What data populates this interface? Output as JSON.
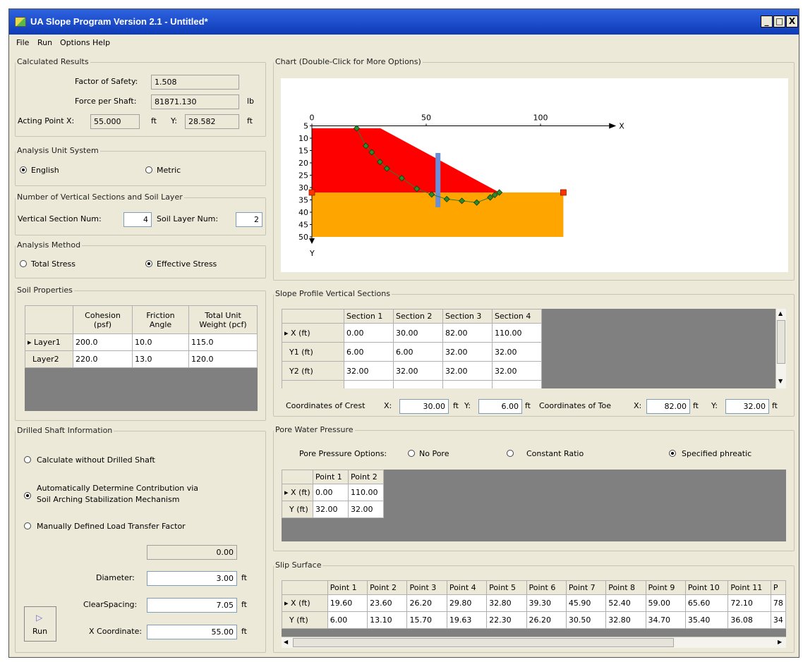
{
  "window": {
    "title": "UA Slope Program Version 2.1 - Untitled*",
    "controls": [
      "_",
      "□",
      "X"
    ]
  },
  "menu": [
    "File",
    "Run",
    "Options",
    "Help"
  ],
  "results": {
    "group": "Calculated Results",
    "fos_label": "Factor of Safety:",
    "fos": "1.508",
    "force_label": "Force per Shaft:",
    "force": "81871.130",
    "force_unit": "lb",
    "acting_label": "Acting Point X:",
    "acting_x": "55.000",
    "x_unit": "ft",
    "y_label": "Y:",
    "acting_y": "28.582",
    "y_unit": "ft"
  },
  "units": {
    "group": "Analysis Unit System",
    "english": "English",
    "metric": "Metric",
    "selected": "English"
  },
  "sections": {
    "group": "Number of Vertical Sections and Soil Layer",
    "vs_label": "Vertical Section Num:",
    "vs": "4",
    "sl_label": "Soil Layer Num:",
    "sl": "2"
  },
  "method": {
    "group": "Analysis Method",
    "total": "Total Stress",
    "effective": "Effective Stress",
    "selected": "Effective Stress"
  },
  "soil": {
    "group": "Soil Properties",
    "headers": [
      "Cohesion (psf)",
      "Friction Angle",
      "Total Unit Weight (pcf)"
    ],
    "rows": [
      {
        "name": "Layer1",
        "vals": [
          "200.0",
          "10.0",
          "115.0"
        ]
      },
      {
        "name": "Layer2",
        "vals": [
          "220.0",
          "13.0",
          "120.0"
        ]
      }
    ]
  },
  "shaft": {
    "group": "Drilled Shaft Information",
    "opt1": "Calculate without Drilled Shaft",
    "opt2a": "Automatically Determine Contribution via",
    "opt2b": "Soil Arching Stabilization Mechanism",
    "opt3": "Manually Defined Load Transfer Factor",
    "ltf": "0.00",
    "dia_label": "Diameter:",
    "dia": "3.00",
    "dia_unit": "ft",
    "cs_label": "ClearSpacing:",
    "cs": "7.05",
    "cs_unit": "ft",
    "xc_label": "X Coordinate:",
    "xc": "55.00",
    "xc_unit": "ft",
    "run": "Run"
  },
  "chart": {
    "group": "Chart (Double-Click for More Options)",
    "x_axis_label": "X",
    "y_axis_label": "Y",
    "x_ticks": [
      "0",
      "50",
      "100"
    ],
    "y_ticks": [
      "5",
      "10",
      "15",
      "20",
      "25",
      "30",
      "35",
      "40",
      "45",
      "50"
    ],
    "colors": {
      "layer1": "#ff0000",
      "layer2": "#ffa500",
      "shaft": "#6a8ed8",
      "slip": "#2e7d32"
    },
    "chart_data": {
      "type": "scatter",
      "x_ticks": [
        0,
        50,
        100
      ],
      "y_ticks": [
        5,
        10,
        15,
        20,
        25,
        30,
        35,
        40,
        45,
        50
      ],
      "xlim": [
        0,
        130
      ],
      "ylim": [
        5,
        50
      ],
      "y_inverted": true,
      "slip_x": [
        19.6,
        23.6,
        26.2,
        29.8,
        32.8,
        39.3,
        45.9,
        52.4,
        59.0,
        65.6,
        72.1,
        78.0,
        80.0,
        82.0
      ],
      "slip_y": [
        6.0,
        13.1,
        15.7,
        19.63,
        22.3,
        26.2,
        30.5,
        32.8,
        34.7,
        35.4,
        36.08,
        34.0,
        33.0,
        32.0
      ],
      "layer1": {
        "x": [
          0,
          30,
          82,
          0
        ],
        "y": [
          6,
          6,
          32,
          32
        ]
      },
      "layer2": {
        "x": [
          0,
          110,
          110,
          0
        ],
        "y": [
          32,
          32,
          50,
          50
        ]
      },
      "shaft": {
        "x": 55,
        "y_top": 16,
        "y_bottom": 38
      },
      "markers": [
        {
          "x": 0,
          "y": 32
        },
        {
          "x": 110,
          "y": 32
        }
      ]
    }
  },
  "profile": {
    "group": "Slope Profile Vertical Sections",
    "headers": [
      "Section 1",
      "Section 2",
      "Section 3",
      "Section 4"
    ],
    "rows": [
      {
        "name": "X (ft)",
        "vals": [
          "0.00",
          "30.00",
          "82.00",
          "110.00"
        ]
      },
      {
        "name": "Y1 (ft)",
        "vals": [
          "6.00",
          "6.00",
          "32.00",
          "32.00"
        ]
      },
      {
        "name": "Y2 (ft)",
        "vals": [
          "32.00",
          "32.00",
          "32.00",
          "32.00"
        ]
      }
    ],
    "crest_label": "Coordinates of Crest",
    "cx_label": "X:",
    "cx": "30.00",
    "cx_unit": "ft",
    "cy_label": "Y:",
    "cy": "6.00",
    "cy_unit": "ft",
    "toe_label": "Coordinates of Toe",
    "tx_label": "X:",
    "tx": "82.00",
    "tx_unit": "ft",
    "ty_label": "Y:",
    "ty": "32.00",
    "ty_unit": "ft"
  },
  "pore": {
    "group": "Pore Water Pressure",
    "options_label": "Pore Pressure Options:",
    "no_pore": "No Pore",
    "constant": "Constant Ratio",
    "phreatic": "Specified phreatic",
    "selected": "Specified phreatic",
    "headers": [
      "Point 1",
      "Point 2"
    ],
    "rows": [
      {
        "name": "X (ft)",
        "vals": [
          "0.00",
          "110.00"
        ]
      },
      {
        "name": "Y (ft)",
        "vals": [
          "32.00",
          "32.00"
        ]
      }
    ]
  },
  "slip": {
    "group": "Slip Surface",
    "headers": [
      "Point 1",
      "Point 2",
      "Point 3",
      "Point 4",
      "Point 5",
      "Point 6",
      "Point 7",
      "Point 8",
      "Point 9",
      "Point 10",
      "Point 11",
      "P"
    ],
    "rows": [
      {
        "name": "X (ft)",
        "vals": [
          "19.60",
          "23.60",
          "26.20",
          "29.80",
          "32.80",
          "39.30",
          "45.90",
          "52.40",
          "59.00",
          "65.60",
          "72.10",
          "78"
        ]
      },
      {
        "name": "Y (ft)",
        "vals": [
          "6.00",
          "13.10",
          "15.70",
          "19.63",
          "22.30",
          "26.20",
          "30.50",
          "32.80",
          "34.70",
          "35.40",
          "36.08",
          "34"
        ]
      }
    ]
  }
}
